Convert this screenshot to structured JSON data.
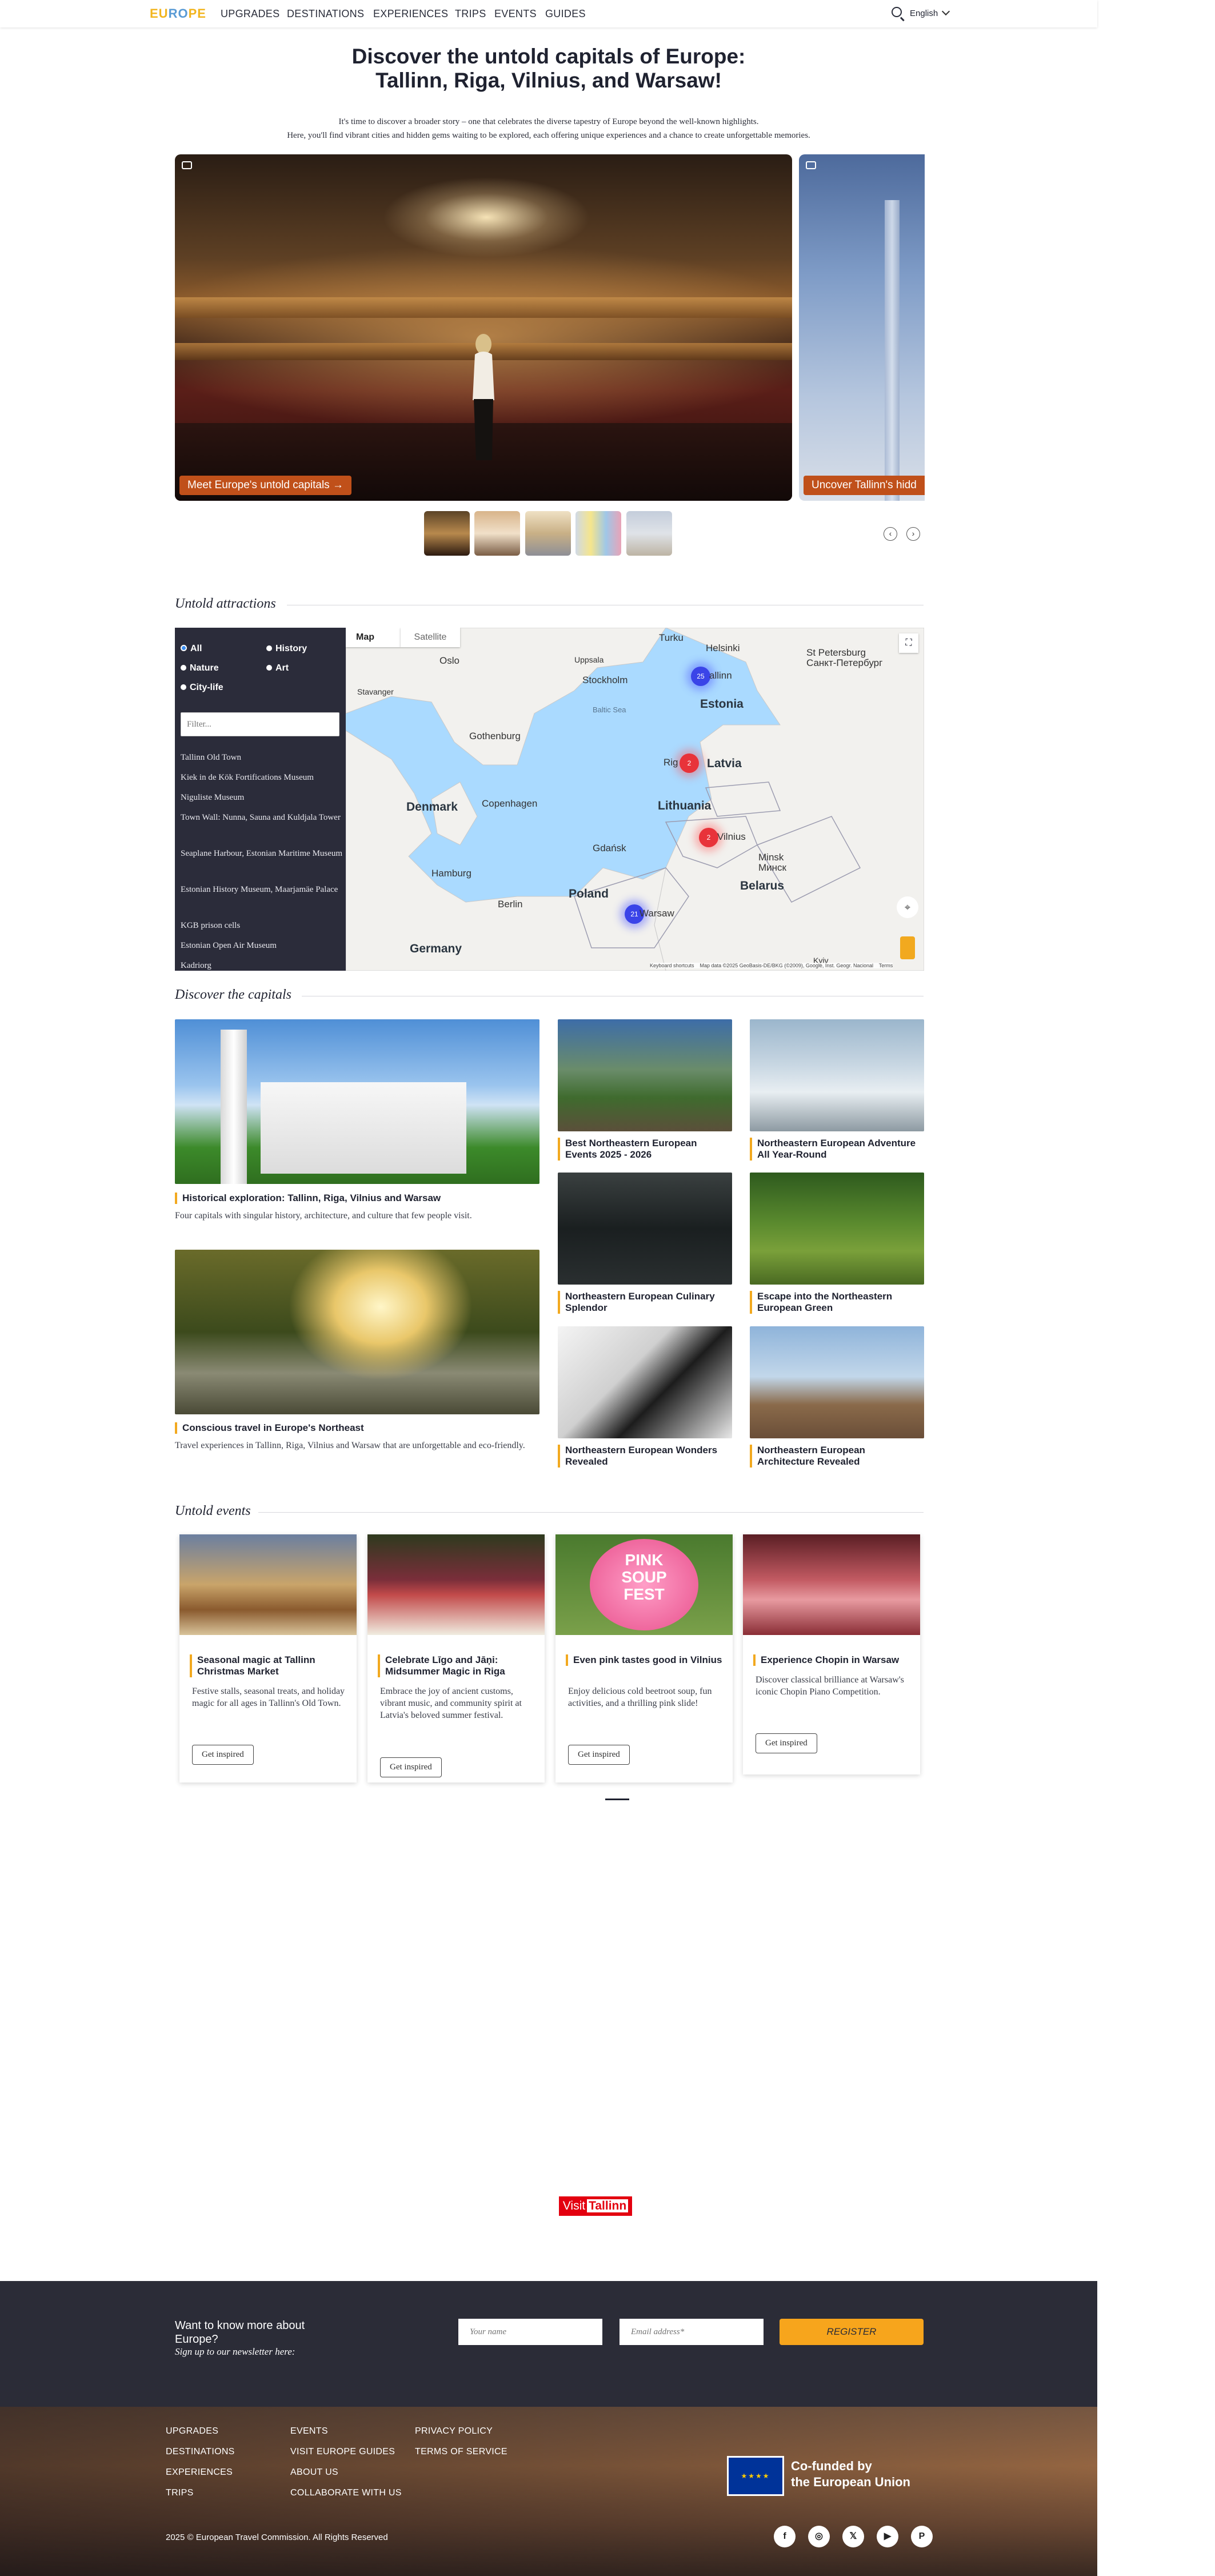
{
  "header": {
    "logo": {
      "e1": "EU",
      "e2": "RO",
      "e3": "PE"
    },
    "nav": [
      "UPGRADES",
      "DESTINATIONS",
      "EXPERIENCES",
      "TRIPS",
      "EVENTS",
      "GUIDES"
    ],
    "language": "English",
    "icons": {
      "search": "search-icon",
      "language_chevron": "chevron-down-icon"
    }
  },
  "hero": {
    "title_line1": "Discover the untold capitals of Europe:",
    "title_line2": "Tallinn, Riga, Vilnius, and Warsaw!",
    "intro_line1": "It's time to discover a broader story – one that celebrates the diverse tapestry of Europe beyond the well-known highlights.",
    "intro_line2": "Here, you'll find vibrant cities and hidden gems waiting to be explored, each offering unique experiences and a chance to create unforgettable memories."
  },
  "slider": {
    "slide1_button": "Meet Europe's untold capitals",
    "slide2_button": "Uncover Tallinn's hidd",
    "thumbnails": 5,
    "prev_arrow": "‹",
    "next_arrow": "›"
  },
  "attractions": {
    "title": "Untold attractions",
    "filters": [
      "All",
      "History",
      "Nature",
      "Art",
      "City-life"
    ],
    "filter_placeholder": "Filter...",
    "items": [
      "Tallinn Old Town",
      "Kiek in de Kök Fortifications Museum",
      "Niguliste Museum",
      "Town Wall: Nunna, Sauna and Kuldjala Tower",
      "Seaplane Harbour, Estonian Maritime Museum",
      "Estonian History Museum, Maarjamäe Palace",
      "KGB prison cells",
      "Estonian Open Air Museum",
      "Kadriorg"
    ],
    "map": {
      "tab_map": "Map",
      "tab_satellite": "Satellite",
      "countries": [
        "Estonia",
        "Latvia",
        "Lithuania",
        "Belarus",
        "Poland",
        "Denmark",
        "Germany"
      ],
      "cities": [
        "Oslo",
        "Stockholm",
        "Helsinki",
        "Turku",
        "Uppsala",
        "Stavanger",
        "Gothenburg",
        "Copenhagen",
        "Hamburg",
        "Berlin",
        "Gdańsk",
        "Minsk",
        "Минск",
        "St Petersburg",
        "Санкт-Петербург",
        "Kyiv"
      ],
      "sea": "Baltic Sea",
      "clusters": [
        {
          "city": "Tallinn",
          "label": "allinn",
          "count": "25",
          "color": "#3a44e8"
        },
        {
          "city": "Riga",
          "label": "Rig",
          "count": "2",
          "color": "#e8333a"
        },
        {
          "city": "Vilnius",
          "label": "Vilnius",
          "count": "2",
          "color": "#e8333a"
        },
        {
          "city": "Warsaw",
          "label": "Warsaw",
          "count": "21",
          "color": "#3a44e8"
        }
      ],
      "footer": "Keyboard shortcuts    Map data ©2025 GeoBasis-DE/BKG (©2009), Google, Inst. Geogr. Nacional    Terms"
    }
  },
  "capitals": {
    "title": "Discover the capitals",
    "big_cards": [
      {
        "title": "Historical exploration: Tallinn, Riga, Vilnius and Warsaw",
        "desc": "Four capitals with singular history, architecture, and culture that few people visit."
      },
      {
        "title": "Conscious travel in Europe's Northeast",
        "desc": "Travel experiences in Tallinn, Riga, Vilnius and Warsaw that are unforgettable and eco-friendly."
      }
    ],
    "small_cards": [
      "Best Northeastern European Events 2025 - 2026",
      "Northeastern European Adventure All Year-Round",
      "Northeastern European Culinary Splendor",
      "Escape into the Northeastern European Green",
      "Northeastern European Wonders Revealed",
      "Northeastern European Architecture Revealed"
    ]
  },
  "events": {
    "title": "Untold events",
    "cards": [
      {
        "title": "Seasonal magic at Tallinn Christmas Market",
        "desc": "Festive stalls, seasonal treats, and holiday magic for all ages in Tallinn's Old Town.",
        "button": "Get inspired"
      },
      {
        "title": "Celebrate Līgo and Jāņi: Midsummer Magic in Riga",
        "desc": "Embrace the joy of ancient customs, vibrant music, and community spirit at Latvia's beloved summer festival.",
        "button": "Get inspired"
      },
      {
        "title": "Even pink tastes good in Vilnius",
        "desc": "Enjoy delicious cold beetroot soup, fun activities, and a thrilling pink slide!",
        "button": "Get inspired"
      },
      {
        "title": "Experience Chopin in Warsaw",
        "desc": "Discover classical brilliance at Warsaw's iconic Chopin Piano Competition.",
        "button": "Get inspired"
      }
    ],
    "festival_sign": {
      "l1": "PINK",
      "l2": "SOUP",
      "l3": "FEST"
    }
  },
  "partner": {
    "visit": "Visit",
    "city": "Tallinn"
  },
  "newsletter": {
    "heading": "Want to know more about Europe?",
    "sub": "Sign up to our newsletter here:",
    "name_placeholder": "Your name",
    "email_placeholder": "Email address*",
    "button": "REGISTER"
  },
  "footer": {
    "col1": [
      "UPGRADES",
      "DESTINATIONS",
      "EXPERIENCES",
      "TRIPS"
    ],
    "col2": [
      "EVENTS",
      "VISIT EUROPE GUIDES",
      "ABOUT US",
      "COLLABORATE WITH US"
    ],
    "col3": [
      "PRIVACY POLICY",
      "TERMS OF SERVICE"
    ],
    "eu_text_l1": "Co-funded by",
    "eu_text_l2": "the European Union",
    "copyright": "2025 © European Travel Commission. All Rights Reserved",
    "social": [
      "facebook-icon",
      "instagram-icon",
      "x-icon",
      "youtube-icon",
      "pinterest-icon"
    ],
    "social_glyphs": [
      "f",
      "◎",
      "𝕏",
      "▶",
      "P"
    ]
  },
  "colors": {
    "accent": "#f2a91f",
    "slide_button": "#c0501a",
    "dark": "#2b2c37",
    "partner_red": "#e3000f"
  }
}
